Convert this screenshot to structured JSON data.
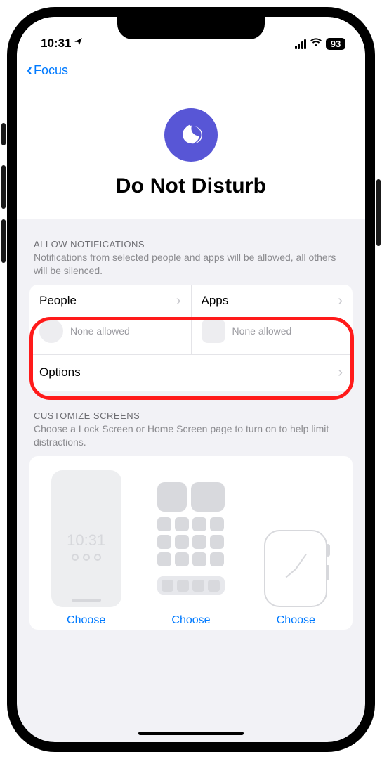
{
  "status": {
    "time": "10:31",
    "battery": "93"
  },
  "nav": {
    "back": "Focus"
  },
  "hero": {
    "title": "Do Not Disturb"
  },
  "allow": {
    "header": "ALLOW NOTIFICATIONS",
    "desc": "Notifications from selected people and apps will be allowed, all others will be silenced.",
    "people": {
      "title": "People",
      "status": "None allowed"
    },
    "apps": {
      "title": "Apps",
      "status": "None allowed"
    },
    "options": "Options"
  },
  "customize": {
    "header": "CUSTOMIZE SCREENS",
    "desc": "Choose a Lock Screen or Home Screen page to turn on to help limit distractions.",
    "lock_time": "10:31",
    "choose": "Choose"
  }
}
